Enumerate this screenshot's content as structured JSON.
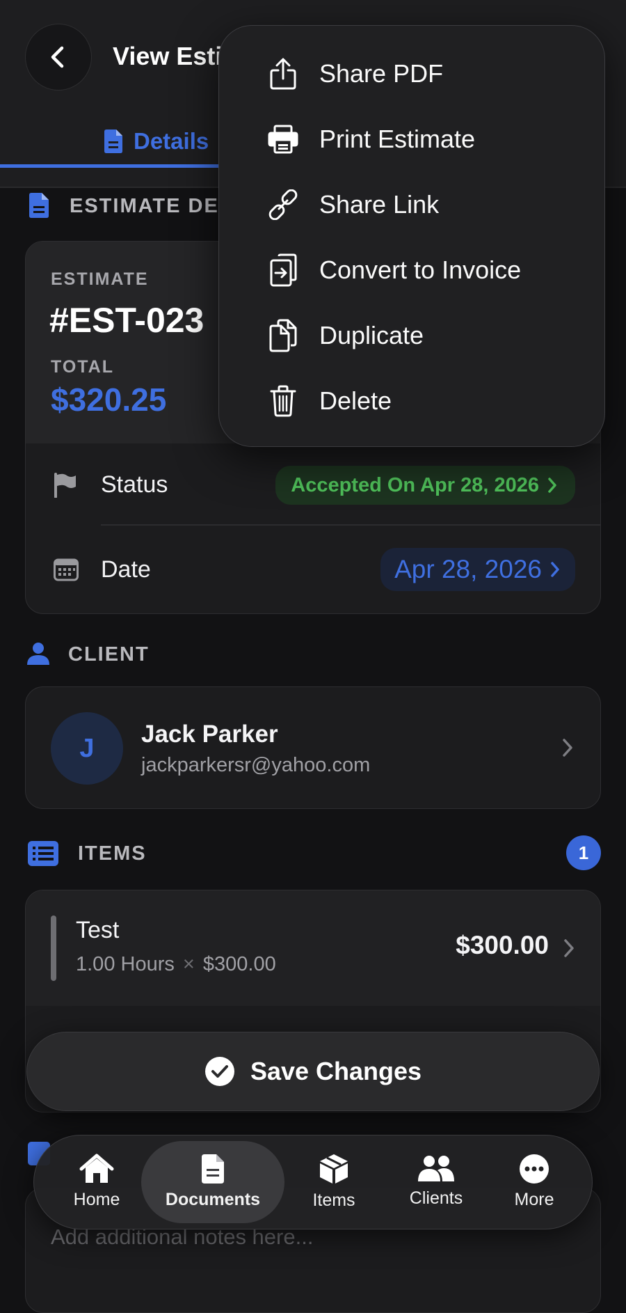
{
  "header": {
    "title": "View Esti",
    "tabs": [
      {
        "label": "Details"
      }
    ]
  },
  "menu": {
    "items": [
      {
        "label": "Share PDF",
        "icon": "share-icon"
      },
      {
        "label": "Print Estimate",
        "icon": "printer-icon"
      },
      {
        "label": "Share Link",
        "icon": "link-icon"
      },
      {
        "label": "Convert to Invoice",
        "icon": "convert-icon"
      },
      {
        "label": "Duplicate",
        "icon": "duplicate-icon"
      },
      {
        "label": "Delete",
        "icon": "trash-icon"
      }
    ]
  },
  "estimate_section": {
    "title": "ESTIMATE DE"
  },
  "summary": {
    "estimate_label": "ESTIMATE",
    "number": "#EST-023",
    "total_label": "TOTAL",
    "total": "$320.25",
    "status_label": "Status",
    "status_value": "Accepted On Apr 28, 2026",
    "date_label": "Date",
    "date_value": "Apr 28, 2026"
  },
  "client_section": {
    "title": "CLIENT"
  },
  "client": {
    "initial": "J",
    "name": "Jack Parker",
    "email": "jackparkersr@yahoo.com"
  },
  "items_section": {
    "title": "ITEMS",
    "count": "1"
  },
  "items": [
    {
      "name": "Test",
      "detail_qty": "1.00 Hours",
      "detail_sep": "×",
      "detail_rate": "$300.00",
      "amount": "$300.00"
    }
  ],
  "save_button": {
    "label": "Save Changes"
  },
  "notes": {
    "placeholder": "Add additional notes here..."
  },
  "tabbar": {
    "items": [
      {
        "label": "Home",
        "icon": "home-icon"
      },
      {
        "label": "Documents",
        "icon": "document-icon",
        "active": true
      },
      {
        "label": "Items",
        "icon": "box-icon"
      },
      {
        "label": "Clients",
        "icon": "people-icon"
      },
      {
        "label": "More",
        "icon": "more-icon"
      }
    ]
  },
  "colors": {
    "accent": "#3f6fe0",
    "status_green": "#4fc05a",
    "background": "#121214",
    "card": "#1c1c1e"
  }
}
